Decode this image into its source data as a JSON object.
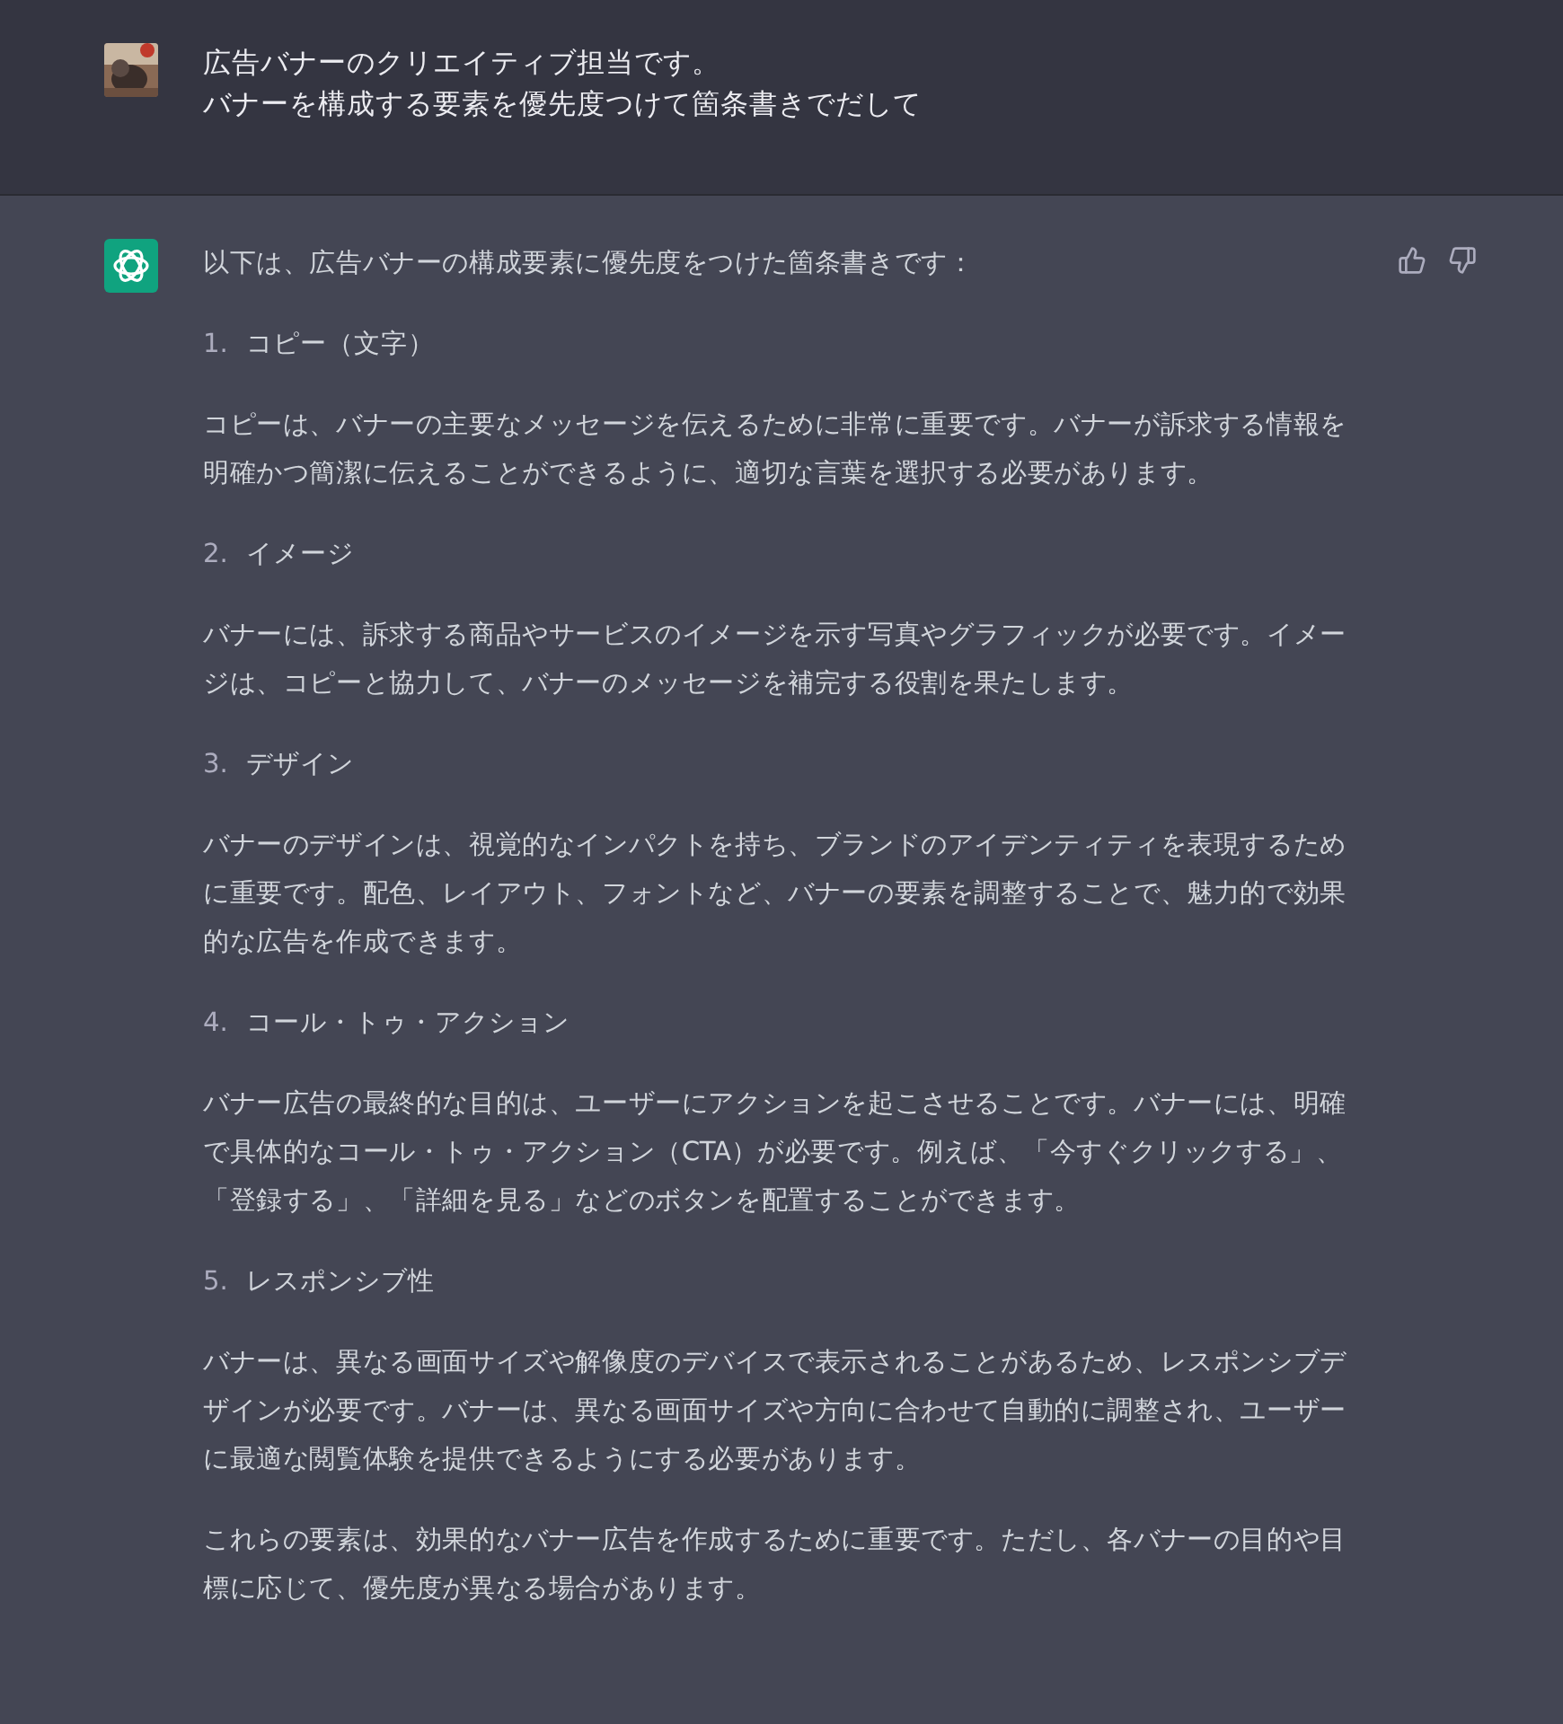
{
  "user_message": {
    "lines": [
      "広告バナーのクリエイティブ担当です。",
      "バナーを構成する要素を優先度つけて箇条書きでだして"
    ]
  },
  "assistant_message": {
    "intro": "以下は、広告バナーの構成要素に優先度をつけた箇条書きです：",
    "items": [
      {
        "number": "1.",
        "title": "コピー（文字）",
        "body": "コピーは、バナーの主要なメッセージを伝えるために非常に重要です。バナーが訴求する情報を明確かつ簡潔に伝えることができるように、適切な言葉を選択する必要があります。"
      },
      {
        "number": "2.",
        "title": "イメージ",
        "body": "バナーには、訴求する商品やサービスのイメージを示す写真やグラフィックが必要です。イメージは、コピーと協力して、バナーのメッセージを補完する役割を果たします。"
      },
      {
        "number": "3.",
        "title": "デザイン",
        "body": "バナーのデザインは、視覚的なインパクトを持ち、ブランドのアイデンティティを表現するために重要です。配色、レイアウト、フォントなど、バナーの要素を調整することで、魅力的で効果的な広告を作成できます。"
      },
      {
        "number": "4.",
        "title": "コール・トゥ・アクション",
        "body": "バナー広告の最終的な目的は、ユーザーにアクションを起こさせることです。バナーには、明確で具体的なコール・トゥ・アクション（CTA）が必要です。例えば、「今すぐクリックする」、「登録する」、「詳細を見る」などのボタンを配置することができます。"
      },
      {
        "number": "5.",
        "title": "レスポンシブ性",
        "body": "バナーは、異なる画面サイズや解像度のデバイスで表示されることがあるため、レスポンシブデザインが必要です。バナーは、異なる画面サイズや方向に合わせて自動的に調整され、ユーザーに最適な閲覧体験を提供できるようにする必要があります。"
      }
    ],
    "conclusion": "これらの要素は、効果的なバナー広告を作成するために重要です。ただし、各バナーの目的や目標に応じて、優先度が異なる場合があります。"
  }
}
